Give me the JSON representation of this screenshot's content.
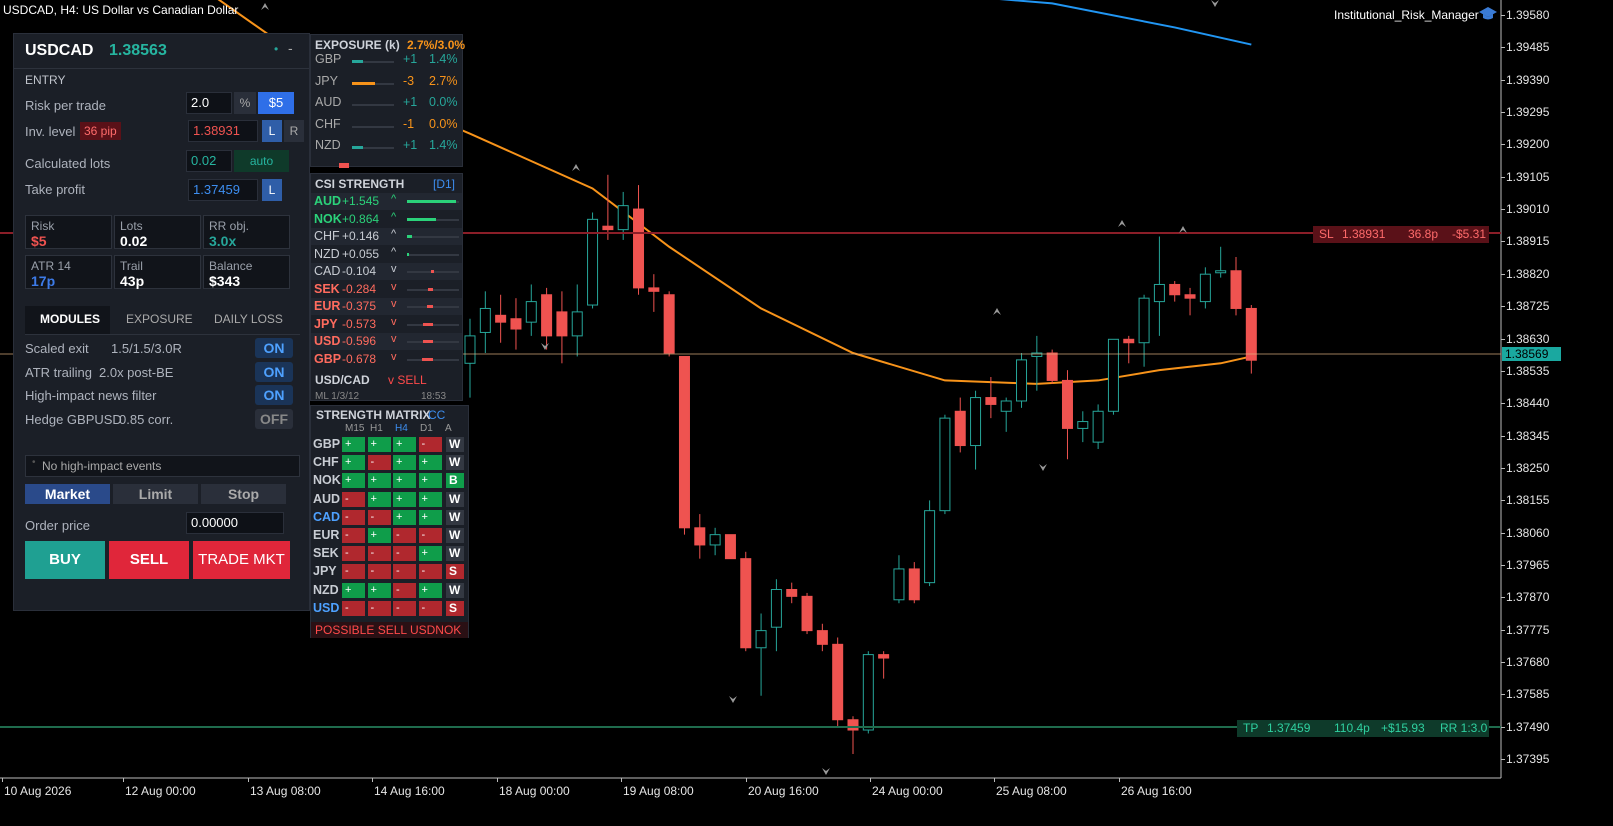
{
  "chart": {
    "header": "USDCAD, H4:  US Dollar vs Canadian Dollar",
    "indicator_name": "Institutional_Risk_Manager",
    "y_axis": [
      "1.39580",
      "1.39485",
      "1.39390",
      "1.39295",
      "1.39200",
      "1.39105",
      "1.39010",
      "1.38915",
      "1.38820",
      "1.38725",
      "1.38630",
      "1.38535",
      "1.38440",
      "1.38345",
      "1.38250",
      "1.38155",
      "1.38060",
      "1.37965",
      "1.37870",
      "1.37775",
      "1.37680",
      "1.37585",
      "1.37490",
      "1.37395"
    ],
    "x_axis": [
      "10 Aug 2026",
      "12 Aug 00:00",
      "13 Aug 08:00",
      "14 Aug 16:00",
      "18 Aug 00:00",
      "19 Aug 08:00",
      "20 Aug 16:00",
      "24 Aug 00:00",
      "25 Aug 08:00",
      "26 Aug 16:00"
    ],
    "current_price": "1.38569",
    "sl_line": {
      "label": "SL",
      "price": "1.38931",
      "distance": "36.8p",
      "amount": "-$5.31"
    },
    "tp_line": {
      "label": "TP",
      "price": "1.37459",
      "distance": "110.4p",
      "amount": "+$15.93",
      "rr": "RR 1:3.0"
    },
    "colors": {
      "bull": "#26a69a",
      "bear": "#ef5350",
      "ma_orange": "#f7931a",
      "ma_blue": "#2196f3",
      "sl": "#8b1e28",
      "tp": "#1f6b4d"
    }
  },
  "chart_data": {
    "type": "candlestick",
    "symbol": "USDCAD",
    "timeframe": "H4",
    "ylim": [
      1.3735,
      1.3962
    ],
    "candles": [
      {
        "o": 1.3856,
        "h": 1.3869,
        "l": 1.3846,
        "c": 1.3864
      },
      {
        "o": 1.3865,
        "h": 1.3877,
        "l": 1.3859,
        "c": 1.3872
      },
      {
        "o": 1.387,
        "h": 1.3876,
        "l": 1.3862,
        "c": 1.3868
      },
      {
        "o": 1.3869,
        "h": 1.3875,
        "l": 1.386,
        "c": 1.3866
      },
      {
        "o": 1.3868,
        "h": 1.3879,
        "l": 1.3864,
        "c": 1.3874
      },
      {
        "o": 1.3876,
        "h": 1.3878,
        "l": 1.386,
        "c": 1.3864
      },
      {
        "o": 1.3871,
        "h": 1.3877,
        "l": 1.3856,
        "c": 1.3864
      },
      {
        "o": 1.3864,
        "h": 1.3879,
        "l": 1.3858,
        "c": 1.3871
      },
      {
        "o": 1.3873,
        "h": 1.39,
        "l": 1.3872,
        "c": 1.3898
      },
      {
        "o": 1.3896,
        "h": 1.3911,
        "l": 1.3892,
        "c": 1.3895
      },
      {
        "o": 1.3895,
        "h": 1.3906,
        "l": 1.3892,
        "c": 1.3902
      },
      {
        "o": 1.3901,
        "h": 1.3908,
        "l": 1.3876,
        "c": 1.3878
      },
      {
        "o": 1.3878,
        "h": 1.3882,
        "l": 1.3871,
        "c": 1.3877
      },
      {
        "o": 1.3876,
        "h": 1.3877,
        "l": 1.3858,
        "c": 1.3859
      },
      {
        "o": 1.3858,
        "h": 1.3858,
        "l": 1.3806,
        "c": 1.3808
      },
      {
        "o": 1.3808,
        "h": 1.3812,
        "l": 1.3799,
        "c": 1.3803
      },
      {
        "o": 1.3803,
        "h": 1.3808,
        "l": 1.38,
        "c": 1.3806
      },
      {
        "o": 1.3806,
        "h": 1.3806,
        "l": 1.3799,
        "c": 1.3799
      },
      {
        "o": 1.3799,
        "h": 1.3801,
        "l": 1.3772,
        "c": 1.3773
      },
      {
        "o": 1.3773,
        "h": 1.3783,
        "l": 1.3759,
        "c": 1.3778
      },
      {
        "o": 1.3779,
        "h": 1.3793,
        "l": 1.3772,
        "c": 1.379
      },
      {
        "o": 1.379,
        "h": 1.3792,
        "l": 1.3786,
        "c": 1.3788
      },
      {
        "o": 1.3788,
        "h": 1.3789,
        "l": 1.3777,
        "c": 1.3778
      },
      {
        "o": 1.3778,
        "h": 1.378,
        "l": 1.3772,
        "c": 1.3774
      },
      {
        "o": 1.3774,
        "h": 1.3776,
        "l": 1.375,
        "c": 1.3752
      },
      {
        "o": 1.3752,
        "h": 1.3753,
        "l": 1.3742,
        "c": 1.3749
      },
      {
        "o": 1.3749,
        "h": 1.3772,
        "l": 1.3748,
        "c": 1.3771
      },
      {
        "o": 1.3771,
        "h": 1.3772,
        "l": 1.3764,
        "c": 1.377
      },
      {
        "o": 1.3787,
        "h": 1.38,
        "l": 1.3786,
        "c": 1.3796
      },
      {
        "o": 1.3796,
        "h": 1.3798,
        "l": 1.3786,
        "c": 1.3787
      },
      {
        "o": 1.3792,
        "h": 1.3816,
        "l": 1.3791,
        "c": 1.3813
      },
      {
        "o": 1.3813,
        "h": 1.3841,
        "l": 1.3812,
        "c": 1.384
      },
      {
        "o": 1.3842,
        "h": 1.3846,
        "l": 1.383,
        "c": 1.3832
      },
      {
        "o": 1.3832,
        "h": 1.3848,
        "l": 1.3825,
        "c": 1.3846
      },
      {
        "o": 1.3846,
        "h": 1.3852,
        "l": 1.384,
        "c": 1.3844
      },
      {
        "o": 1.3842,
        "h": 1.3846,
        "l": 1.3836,
        "c": 1.3845
      },
      {
        "o": 1.3845,
        "h": 1.3859,
        "l": 1.3843,
        "c": 1.3857
      },
      {
        "o": 1.3858,
        "h": 1.3864,
        "l": 1.3848,
        "c": 1.3859
      },
      {
        "o": 1.3859,
        "h": 1.386,
        "l": 1.385,
        "c": 1.3851
      },
      {
        "o": 1.3851,
        "h": 1.3854,
        "l": 1.3828,
        "c": 1.3837
      },
      {
        "o": 1.3837,
        "h": 1.3842,
        "l": 1.3833,
        "c": 1.3839
      },
      {
        "o": 1.3833,
        "h": 1.3844,
        "l": 1.3831,
        "c": 1.3842
      },
      {
        "o": 1.3842,
        "h": 1.3863,
        "l": 1.3841,
        "c": 1.3863
      },
      {
        "o": 1.3863,
        "h": 1.3864,
        "l": 1.3856,
        "c": 1.3862
      },
      {
        "o": 1.3862,
        "h": 1.3876,
        "l": 1.3855,
        "c": 1.3875
      },
      {
        "o": 1.3874,
        "h": 1.3893,
        "l": 1.3864,
        "c": 1.3879
      },
      {
        "o": 1.3879,
        "h": 1.388,
        "l": 1.3874,
        "c": 1.3876
      },
      {
        "o": 1.3876,
        "h": 1.3878,
        "l": 1.387,
        "c": 1.3875
      },
      {
        "o": 1.3874,
        "h": 1.3884,
        "l": 1.3872,
        "c": 1.3882
      },
      {
        "o": 1.3883,
        "h": 1.389,
        "l": 1.3881,
        "c": 1.3883
      },
      {
        "o": 1.3883,
        "h": 1.3887,
        "l": 1.387,
        "c": 1.3872
      },
      {
        "o": 1.3872,
        "h": 1.3873,
        "l": 1.3853,
        "c": 1.38569
      }
    ],
    "moving_averages": [
      {
        "color": "#f7931a",
        "points": [
          {
            "i": -17,
            "v": 1.3964
          },
          {
            "i": -10,
            "v": 1.3942
          },
          {
            "i": 0,
            "v": 1.3923
          },
          {
            "i": 8,
            "v": 1.3907
          },
          {
            "i": 13,
            "v": 1.389
          },
          {
            "i": 19,
            "v": 1.3872
          },
          {
            "i": 25,
            "v": 1.3859
          },
          {
            "i": 31,
            "v": 1.3851
          },
          {
            "i": 37,
            "v": 1.385
          },
          {
            "i": 41,
            "v": 1.3851
          },
          {
            "i": 45,
            "v": 1.3854
          },
          {
            "i": 49,
            "v": 1.3856
          },
          {
            "i": 51,
            "v": 1.3858
          }
        ]
      },
      {
        "color": "#2196f3",
        "points": [
          {
            "i": 30,
            "v": 1.3964
          },
          {
            "i": 38,
            "v": 1.3961
          },
          {
            "i": 46,
            "v": 1.3954
          },
          {
            "i": 51,
            "v": 1.3949
          }
        ]
      }
    ]
  },
  "trade_panel": {
    "symbol": "USDCAD",
    "price": "1.38563",
    "entry_title": "ENTRY",
    "risk_label": "Risk per trade",
    "risk_value": "2.0",
    "risk_unit": "%",
    "risk_dollar_btn": "$5",
    "inv_label": "Inv. level",
    "inv_pip": "36 pip",
    "inv_value": "1.38931",
    "l_btn": "L",
    "r_btn": "R",
    "lots_label": "Calculated lots",
    "lots_value": "0.02",
    "lots_mode": "auto",
    "tp_label": "Take profit",
    "tp_value": "1.37459",
    "tp_l_btn": "L",
    "tiles": [
      {
        "t": "Risk",
        "v": "$5",
        "color": "#ef5350"
      },
      {
        "t": "Lots",
        "v": "0.02",
        "color": "#ffffff"
      },
      {
        "t": "RR obj.",
        "v": "3.0x",
        "color": "#26a69a"
      },
      {
        "t": "ATR 14",
        "v": "17p",
        "color": "#3d7be8"
      },
      {
        "t": "Trail",
        "v": "43p",
        "color": "#ffffff"
      },
      {
        "t": "Balance",
        "v": "$343",
        "color": "#ffffff"
      }
    ],
    "tabs": [
      "MODULES",
      "EXPOSURE",
      "DAILY LOSS"
    ],
    "modules": [
      {
        "name": "Scaled exit",
        "detail": "1.5/1.5/3.0R",
        "state": "ON"
      },
      {
        "name": "ATR trailing",
        "detail": "2.0x post-BE",
        "state": "ON"
      },
      {
        "name": "High-impact news filter",
        "detail": "",
        "state": "ON"
      },
      {
        "name": "Hedge GBPUSD",
        "detail": "0.85 corr.",
        "state": "OFF"
      }
    ],
    "news_text": "No high-impact events",
    "order_types": [
      "Market",
      "Limit",
      "Stop"
    ],
    "order_price_label": "Order price",
    "order_price_value": "0.00000",
    "buy_label": "BUY",
    "sell_label": "SELL",
    "trade_label": "TRADE MKT"
  },
  "exposure": {
    "title": "EXPOSURE (k)",
    "summary": "2.7%/3.0%",
    "rows": [
      {
        "ccy": "GBP",
        "delta": "+1",
        "pct": "1.4%",
        "bar": 0.25,
        "color": "#26a69a"
      },
      {
        "ccy": "JPY",
        "delta": "-3",
        "pct": "2.7%",
        "bar": 0.55,
        "color": "#f7931a"
      },
      {
        "ccy": "AUD",
        "delta": "+1",
        "pct": "0.0%",
        "bar": 0.0,
        "color": "#26a69a"
      },
      {
        "ccy": "CHF",
        "delta": "-1",
        "pct": "0.0%",
        "bar": 0.0,
        "color": "#f7931a"
      },
      {
        "ccy": "NZD",
        "delta": "+1",
        "pct": "1.4%",
        "bar": 0.25,
        "color": "#26a69a"
      }
    ]
  },
  "csi": {
    "title": "CSI STRENGTH",
    "tf": "[D1]",
    "rows": [
      {
        "ccy": "AUD",
        "val": "+1.545",
        "dir": "^",
        "bar": 0.95,
        "color": "#2bd27a",
        "bold": true
      },
      {
        "ccy": "NOK",
        "val": "+0.864",
        "dir": "^",
        "bar": 0.55,
        "color": "#2bd27a",
        "bold": true
      },
      {
        "ccy": "CHF",
        "val": "+0.146",
        "dir": "^",
        "bar": 0.1,
        "color": "#c8ccd3",
        "bold": false
      },
      {
        "ccy": "NZD",
        "val": "+0.055",
        "dir": "^",
        "bar": 0.04,
        "color": "#c8ccd3",
        "bold": false
      },
      {
        "ccy": "CAD",
        "val": "-0.104",
        "dir": "v",
        "bar": 0.07,
        "color": "#c8ccd3",
        "bold": false
      },
      {
        "ccy": "SEK",
        "val": "-0.284",
        "dir": "v",
        "bar": 0.18,
        "color": "#ff6b5e",
        "bold": true
      },
      {
        "ccy": "EUR",
        "val": "-0.375",
        "dir": "v",
        "bar": 0.24,
        "color": "#ff6b5e",
        "bold": true
      },
      {
        "ccy": "JPY",
        "val": "-0.573",
        "dir": "v",
        "bar": 0.37,
        "color": "#ff6b5e",
        "bold": true
      },
      {
        "ccy": "USD",
        "val": "-0.596",
        "dir": "v",
        "bar": 0.39,
        "color": "#ff6b5e",
        "bold": true
      },
      {
        "ccy": "GBP",
        "val": "-0.678",
        "dir": "v",
        "bar": 0.44,
        "color": "#ff6b5e",
        "bold": true
      }
    ],
    "pair": "USD/CAD",
    "signal": "v SELL",
    "footer_left": "ML 1/3/12",
    "footer_right": "18:53"
  },
  "matrix": {
    "title": "STRENGTH MATRIX",
    "tag": "CC",
    "columns": [
      "M15",
      "H1",
      "H4",
      "D1",
      "A"
    ],
    "rows": [
      {
        "ccy": "GBP",
        "cells": [
          "+",
          "+",
          "+",
          "-"
        ],
        "a": "W"
      },
      {
        "ccy": "CHF",
        "cells": [
          "+",
          "-",
          "+",
          "+"
        ],
        "a": "W"
      },
      {
        "ccy": "NOK",
        "cells": [
          "+",
          "+",
          "+",
          "+"
        ],
        "a": "B"
      },
      {
        "ccy": "AUD",
        "cells": [
          "-",
          "+",
          "+",
          "+"
        ],
        "a": "W"
      },
      {
        "ccy": "CAD",
        "cells": [
          "-",
          "-",
          "+",
          "+"
        ],
        "a": "W"
      },
      {
        "ccy": "EUR",
        "cells": [
          "-",
          "+",
          "-",
          "-"
        ],
        "a": "W"
      },
      {
        "ccy": "SEK",
        "cells": [
          "-",
          "-",
          "-",
          "+"
        ],
        "a": "W"
      },
      {
        "ccy": "JPY",
        "cells": [
          "-",
          "-",
          "-",
          "-"
        ],
        "a": "S"
      },
      {
        "ccy": "NZD",
        "cells": [
          "+",
          "+",
          "-",
          "+"
        ],
        "a": "W"
      },
      {
        "ccy": "USD",
        "cells": [
          "-",
          "-",
          "-",
          "-"
        ],
        "a": "S"
      }
    ],
    "alert": "POSSIBLE SELL USDNOK"
  }
}
